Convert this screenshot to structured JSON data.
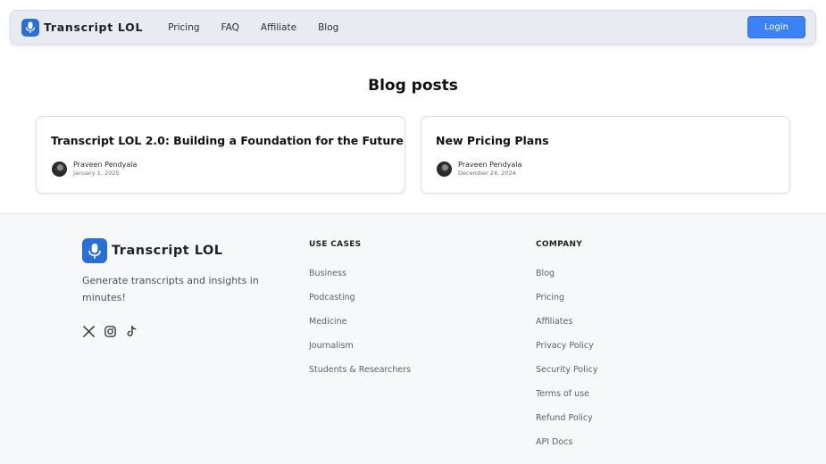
{
  "header": {
    "brand": "Transcript LOL",
    "nav": [
      "Pricing",
      "FAQ",
      "Affiliate",
      "Blog"
    ],
    "login_label": "Login"
  },
  "main": {
    "title": "Blog posts",
    "posts": [
      {
        "title": "Transcript LOL 2.0: Building a Foundation for the Future",
        "author": "Praveen Pendyala",
        "date": "January 1, 2025"
      },
      {
        "title": "New Pricing Plans",
        "author": "Praveen Pendyala",
        "date": "December 24, 2024"
      }
    ]
  },
  "footer": {
    "brand": "Transcript LOL",
    "tagline": "Generate transcripts and insights in minutes!",
    "socials": [
      "x-icon",
      "instagram-icon",
      "tiktok-icon"
    ],
    "use_cases": {
      "heading": "USE CASES",
      "items": [
        "Business",
        "Podcasting",
        "Medicine",
        "Journalism",
        "Students & Researchers"
      ]
    },
    "company": {
      "heading": "COMPANY",
      "items": [
        "Blog",
        "Pricing",
        "Affiliates",
        "Privacy Policy",
        "Security Policy",
        "Terms of use",
        "Refund Policy",
        "API Docs"
      ]
    }
  },
  "colors": {
    "accent": "#3b82f6",
    "logo": "#2a6fd6"
  }
}
